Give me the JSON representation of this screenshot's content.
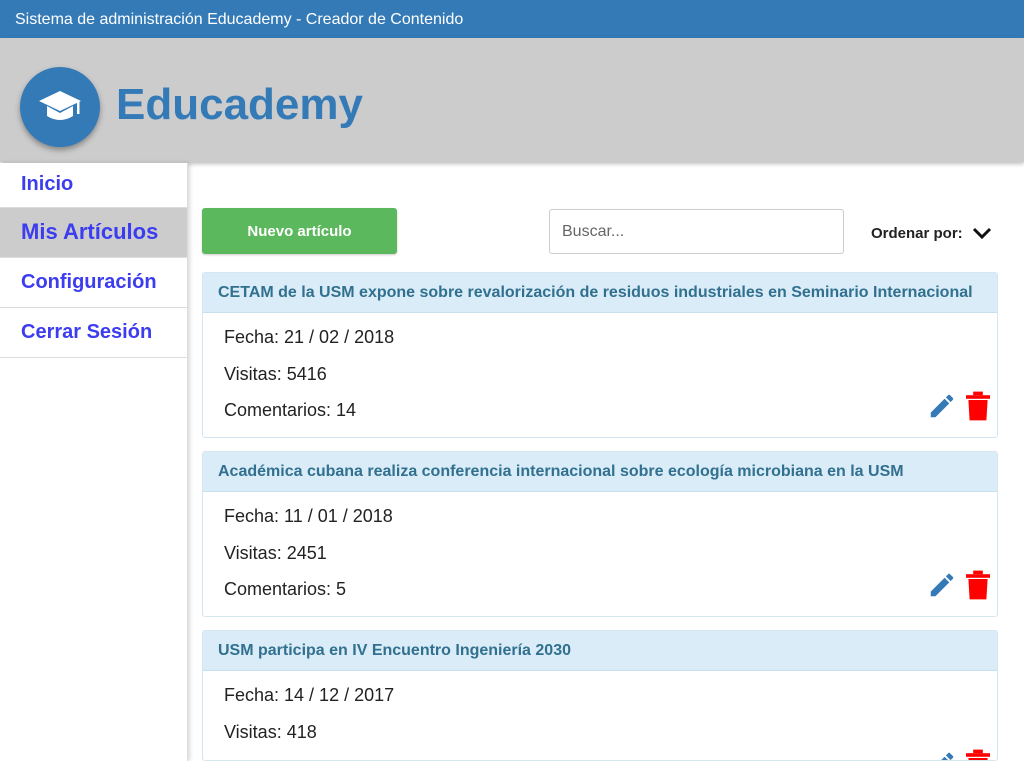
{
  "window": {
    "title": "Sistema de administración Educademy - Creador de Contenido"
  },
  "header": {
    "brand": "Educademy",
    "logo_icon": "graduation-cap-icon"
  },
  "sidebar": {
    "items": [
      {
        "label": "Inicio",
        "active": false
      },
      {
        "label": "Mis Artículos",
        "active": true
      },
      {
        "label": "Configuración",
        "active": false
      },
      {
        "label": "Cerrar Sesión",
        "active": false
      }
    ]
  },
  "toolbar": {
    "new_label": "Nuevo artículo",
    "search_placeholder": "Buscar...",
    "sort_label": "Ordenar por:"
  },
  "articles": [
    {
      "title": "CETAM de la USM expone sobre revalorización de residuos industriales en Seminario Internacional",
      "date": "Fecha: 21 / 02 / 2018",
      "visits": "Visitas: 5416",
      "comments": "Comentarios: 14"
    },
    {
      "title": "Académica cubana realiza conferencia internacional sobre ecología microbiana en la USM",
      "date": "Fecha: 11 / 01 / 2018",
      "visits": "Visitas: 2451",
      "comments": "Comentarios: 5"
    },
    {
      "title": "USM participa en IV Encuentro Ingeniería 2030",
      "date": "Fecha: 14 / 12 / 2017",
      "visits": "Visitas: 418",
      "comments": ""
    }
  ],
  "colors": {
    "primary": "#337ab7",
    "header_bg": "#cccccc",
    "nav_text": "#3c3cf0",
    "new_button": "#5cb85c",
    "card_header_bg": "#d9ecf7",
    "card_title": "#31708f",
    "delete": "#ff0000"
  }
}
